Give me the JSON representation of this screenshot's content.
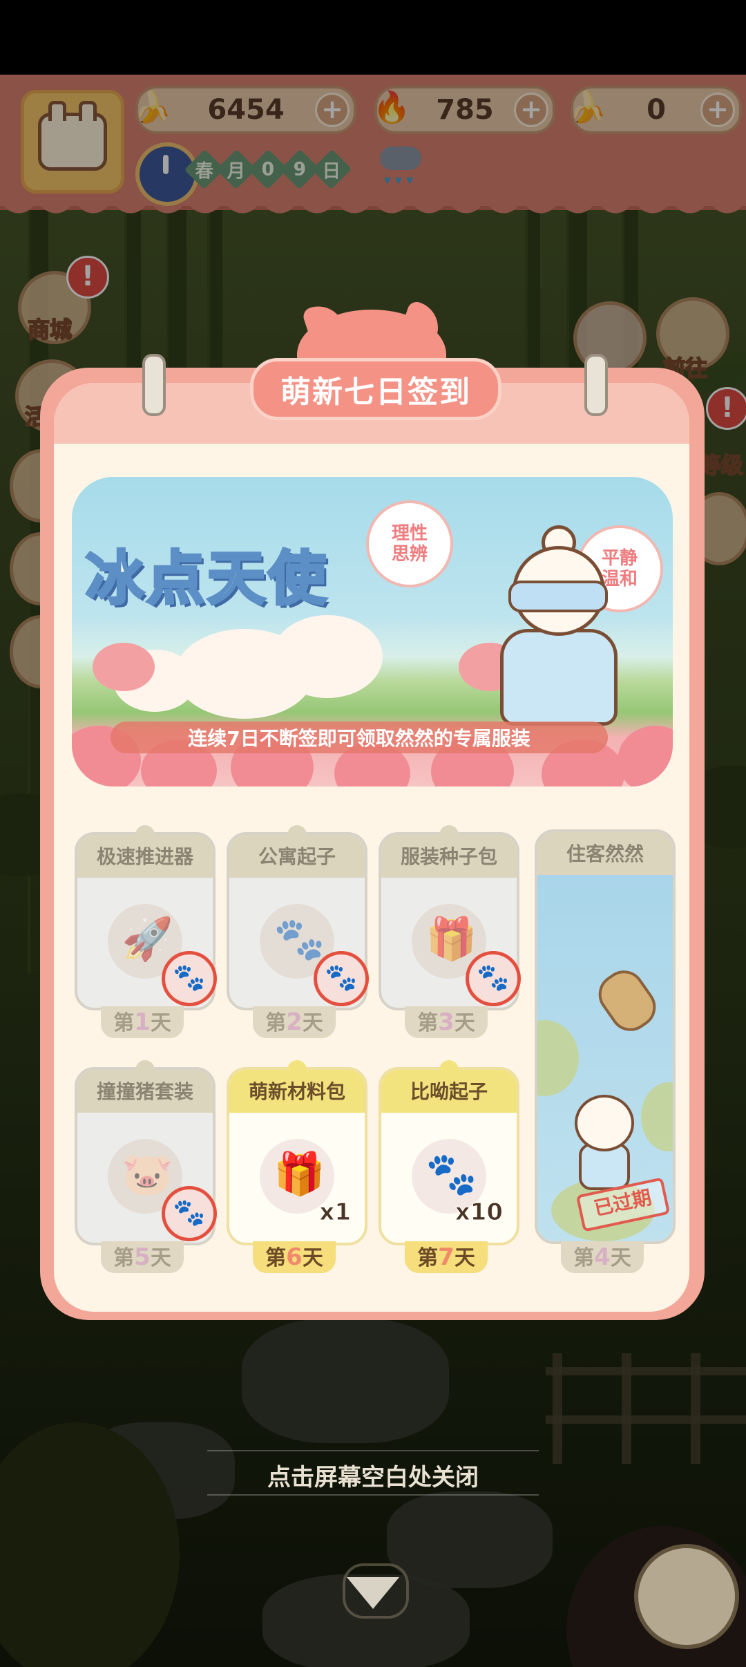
{
  "header": {
    "resources": [
      {
        "name": "banana-icon",
        "value": "6454"
      },
      {
        "name": "flame-icon",
        "value": "785"
      },
      {
        "name": "blue-banana-icon",
        "value": "0"
      }
    ],
    "date_chars": [
      "春",
      "月",
      "0",
      "9",
      "日"
    ]
  },
  "side_menu": {
    "left": [
      {
        "label": "商城",
        "badge": "!"
      },
      {
        "label": "活"
      }
    ],
    "right": [
      {
        "label": "前往"
      },
      {
        "label": "等级",
        "badge": "!"
      }
    ]
  },
  "modal": {
    "title": "萌新七日签到",
    "banner": {
      "title_part1": "冰",
      "title_part2": "点",
      "title_part3": "天",
      "title_part4": "使",
      "tag1": "理性\n思辨",
      "tag2": "平静\n温和",
      "caption": "连续7日不断签即可领取然然的专属服装"
    },
    "days": [
      {
        "name": "极速推进器",
        "day_prefix": "第",
        "day_num": "1",
        "day_suffix": "天",
        "icon": "thruster-icon",
        "claimed": true
      },
      {
        "name": "公寓起子",
        "day_prefix": "第",
        "day_num": "2",
        "day_suffix": "天",
        "icon": "paw-stick-icon",
        "claimed": true
      },
      {
        "name": "服装种子包",
        "day_prefix": "第",
        "day_num": "3",
        "day_suffix": "天",
        "icon": "seed-box-icon",
        "claimed": true
      },
      {
        "name": "撞撞猪套装",
        "day_prefix": "第",
        "day_num": "5",
        "day_suffix": "天",
        "icon": "pig-costume-icon",
        "claimed": true
      },
      {
        "name": "萌新材料包",
        "day_prefix": "第",
        "day_num": "6",
        "day_suffix": "天",
        "icon": "gift-pack-icon",
        "qty": "x1",
        "claimed": false
      },
      {
        "name": "比呦起子",
        "day_prefix": "第",
        "day_num": "7",
        "day_suffix": "天",
        "icon": "paw-stick-icon",
        "qty": "x10",
        "claimed": false
      }
    ],
    "day4": {
      "name": "住客然然",
      "day_prefix": "第",
      "day_num": "4",
      "day_suffix": "天",
      "status": "已过期"
    }
  },
  "footer": {
    "close_hint": "点击屏幕空白处关闭"
  }
}
